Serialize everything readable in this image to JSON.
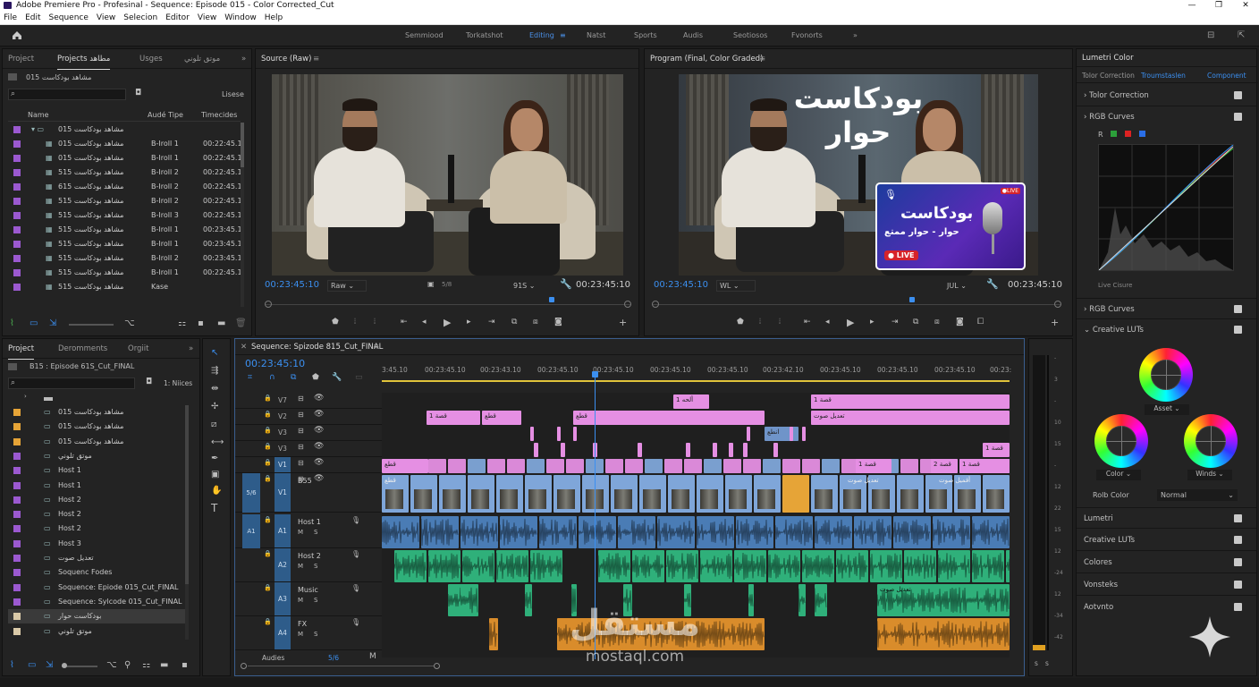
{
  "window": {
    "title": "Adobe Premiere Pro - Profesinal - Sequence: Episode 015 - Color Corrected_Cut",
    "min": "—",
    "max": "❐",
    "close": "✕"
  },
  "menu": [
    "File",
    "Edit",
    "Sequence",
    "View",
    "Selecion",
    "Editor",
    "View",
    "Window",
    "Help"
  ],
  "workspaces": [
    "Semmiood",
    "Torkatshot",
    "Editing",
    "Natst",
    "Sports",
    "Audis",
    "Seotiosos",
    "Fvonorts"
  ],
  "active_workspace": "Editing",
  "project_panel": {
    "tabs": [
      "Project",
      "Projects مطاهد",
      "Usges",
      "موتق تلوني"
    ],
    "bin_name": "مشاهد بودكاست 015",
    "search_placeholder": "",
    "sort_label": "Lisese",
    "columns": [
      "Name",
      "Audé Tipe",
      "Timecides"
    ],
    "rows": [
      {
        "name": "مشاهد بودكاست 015",
        "type": "",
        "tc": "",
        "color": "#9b59d0",
        "folder": true
      },
      {
        "name": "مشاهد بودكاست 015",
        "type": "B-Iroll 1",
        "tc": "00:22:45.1",
        "color": "#9b59d0"
      },
      {
        "name": "مشاهد بودكاست 015",
        "type": "B-Iroll 1",
        "tc": "00:22:45.1",
        "color": "#9b59d0"
      },
      {
        "name": "مشاهد بودكاست 515",
        "type": "B-Iroll 2",
        "tc": "00:22:45.1",
        "color": "#9b59d0"
      },
      {
        "name": "مشاهد بودكاست 615",
        "type": "B-Iroll 2",
        "tc": "00:22:45.1",
        "color": "#9b59d0"
      },
      {
        "name": "مشاهد بودكاست 515",
        "type": "B-Iroll 2",
        "tc": "00:22:45.1",
        "color": "#9b59d0"
      },
      {
        "name": "مشاهد بودكاست 515",
        "type": "B-Iroll 3",
        "tc": "00:22:45.1",
        "color": "#9b59d0"
      },
      {
        "name": "مشاهد بودكاست 515",
        "type": "B-Iroll 1",
        "tc": "00:23:45.1",
        "color": "#9b59d0"
      },
      {
        "name": "مشاهد بودكاست 515",
        "type": "B-Iroll 1",
        "tc": "00:23:45.1",
        "color": "#9b59d0"
      },
      {
        "name": "مشاهد بودكاست 515",
        "type": "B-Iroll 2",
        "tc": "00:23:45.1",
        "color": "#9b59d0"
      },
      {
        "name": "مشاهد بودكاست 515",
        "type": "B-Iroll 1",
        "tc": "00:22:45.1",
        "color": "#9b59d0"
      },
      {
        "name": "مشاهد بودكاست 515",
        "type": "Kase",
        "tc": "",
        "color": "#9b59d0"
      }
    ]
  },
  "project2": {
    "tabs": [
      "Project",
      "Deromments",
      "Orgiit"
    ],
    "path": "B15 : Episode 61S_Cut_FINAL",
    "search_placeholder": "",
    "count_label": "1: Niices",
    "rows": [
      {
        "name": "مشاهد بودكاست 015",
        "color": "#e6a437"
      },
      {
        "name": "مشاهد بودكاست 015",
        "color": "#e6a437"
      },
      {
        "name": "مشاهد بودكاست 015",
        "color": "#e6a437"
      },
      {
        "name": "موتق تلوني",
        "color": "#9b59d0"
      },
      {
        "name": "Host 1",
        "color": "#9b59d0"
      },
      {
        "name": "Host 1",
        "color": "#9b59d0"
      },
      {
        "name": "Host 2",
        "color": "#9b59d0"
      },
      {
        "name": "Host 2",
        "color": "#9b59d0"
      },
      {
        "name": "Host 2",
        "color": "#9b59d0"
      },
      {
        "name": "Host 3",
        "color": "#9b59d0"
      },
      {
        "name": "تعديل صوت",
        "color": "#9b59d0"
      },
      {
        "name": "Soquenc Fodes",
        "color": "#9b59d0"
      },
      {
        "name": "Soquence: Epiode 015_Cut_FINAL",
        "color": "#9b59d0"
      },
      {
        "name": "Sequence: Sylcode 015_Cut_FINAL",
        "color": "#9b59d0"
      },
      {
        "name": "بودكاست حوار",
        "color": "#d9c9a8"
      },
      {
        "name": "موتق تلوني",
        "color": "#d9c9a8"
      }
    ]
  },
  "source": {
    "title": "Source (Raw)",
    "timecode": "00:23:45:10",
    "fit": "Raw",
    "res": "91S",
    "tc_right": "00:23:45:10",
    "small": "5/8"
  },
  "program": {
    "title": "Program (Final, Color Graded)",
    "timecode": "00:23:45:10",
    "fit": "WL",
    "res": "JUL",
    "tc_right": "00:23:45:10",
    "overlay_title_1": "بودكاست",
    "overlay_title_2": "حوار",
    "card_title": "بودكاست",
    "card_sub": "حوار - حوار ممتع",
    "live": "LIVE",
    "live_badge": "LIVE"
  },
  "lumetri": {
    "title": "Lumetri Color",
    "tabs": [
      "Tolor Correction",
      "Troumstaslen",
      "Component"
    ],
    "sections": [
      "Tolor Correction",
      "RGB Curves"
    ],
    "curve_channels": [
      "R"
    ],
    "live_label": "Live Cisure",
    "section2": [
      "RGB Curves",
      "Creative LUTs"
    ],
    "wheels": {
      "top": "Asset",
      "left": "Color",
      "right": "Winds"
    },
    "blend_label": "Rolb Color",
    "blend_value": "Normal",
    "bottom_sections": [
      "Lumetri",
      "Creative LUTs",
      "Colores",
      "Vonsteks",
      "Aotvnto"
    ]
  },
  "timeline": {
    "title": "Sequence: Spizode 815_Cut_FINAL",
    "timecode": "00:23:45:10",
    "ruler": [
      "3:45.10",
      "00:23:45.10",
      "00:23:43.10",
      "00:23:45.10",
      "00:23:45.10",
      "00:23:45.10",
      "00:23:45.10",
      "00:23:42.10",
      "00:23:45.10",
      "00:23:45.10",
      "00:23:45.10",
      "00:23:"
    ],
    "tracks": [
      {
        "id": "V7",
        "label": ""
      },
      {
        "id": "V2",
        "label": ""
      },
      {
        "id": "V3",
        "label": ""
      },
      {
        "id": "V3",
        "label": ""
      },
      {
        "id": "V1",
        "label": ""
      },
      {
        "id": "V1",
        "label": "B55"
      },
      {
        "id": "A1",
        "label": "Host 1"
      },
      {
        "id": "A2",
        "label": "Host 2"
      },
      {
        "id": "A3",
        "label": "Music"
      },
      {
        "id": "A4",
        "label": "FX"
      }
    ],
    "src_patch": [
      "5/6",
      "A1"
    ],
    "clips_text": [
      "ألحه 1",
      "قصة 1",
      "قصة 1",
      "قطع",
      "قطع",
      "تعديل صوت",
      "انطع",
      "قصة 1",
      "قطع",
      "قصة 1",
      "قصة 2",
      "قصة 1",
      "قطع",
      "أقميل صوت",
      "تعديل صوت",
      "تعديل صوت"
    ],
    "audies_label": "Audies",
    "audies_val": "5/6"
  },
  "meter_scale": [
    "-",
    "3",
    "-",
    "10",
    "15",
    "-",
    "12",
    "22",
    "15",
    "12",
    "-24",
    "12",
    "-34",
    "-42"
  ],
  "watermark": {
    "text": "مستقل",
    "url": "mostaql.com"
  },
  "colors": {
    "accent": "#3b8ff0",
    "video_clip": "#7fa6d9",
    "title_clip": "#e58fe3",
    "audio_host1": "#4a7cb5",
    "audio_host2": "#2fb07a",
    "audio_fx": "#d98c2b"
  }
}
